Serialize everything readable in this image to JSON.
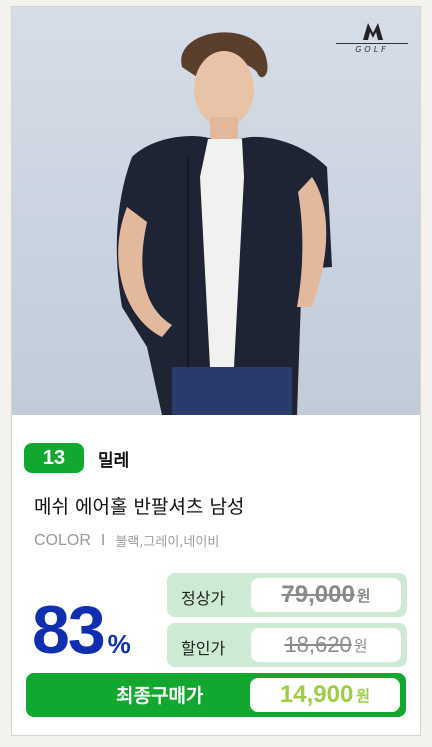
{
  "brand_logo": {
    "word": "GOLF"
  },
  "product": {
    "rank": "13",
    "brand": "밀레",
    "name": "메쉬 에어홀 반팔셔츠 남성",
    "color_label": "COLOR",
    "color_separator": "I",
    "colors": "블랙,그레이,네이비"
  },
  "pricing": {
    "discount_value": "83",
    "discount_unit": "%",
    "regular_label": "정상가",
    "regular_price": "79,000",
    "sale_label": "할인가",
    "sale_price": "18,620",
    "final_label": "최종구매가",
    "final_price": "14,900",
    "currency": "원"
  },
  "colors": {
    "accent_green": "#12a82f",
    "price_box_green": "#cdebd2",
    "discount_blue": "#0f2fb0",
    "final_price_lime": "#9ccd45"
  }
}
